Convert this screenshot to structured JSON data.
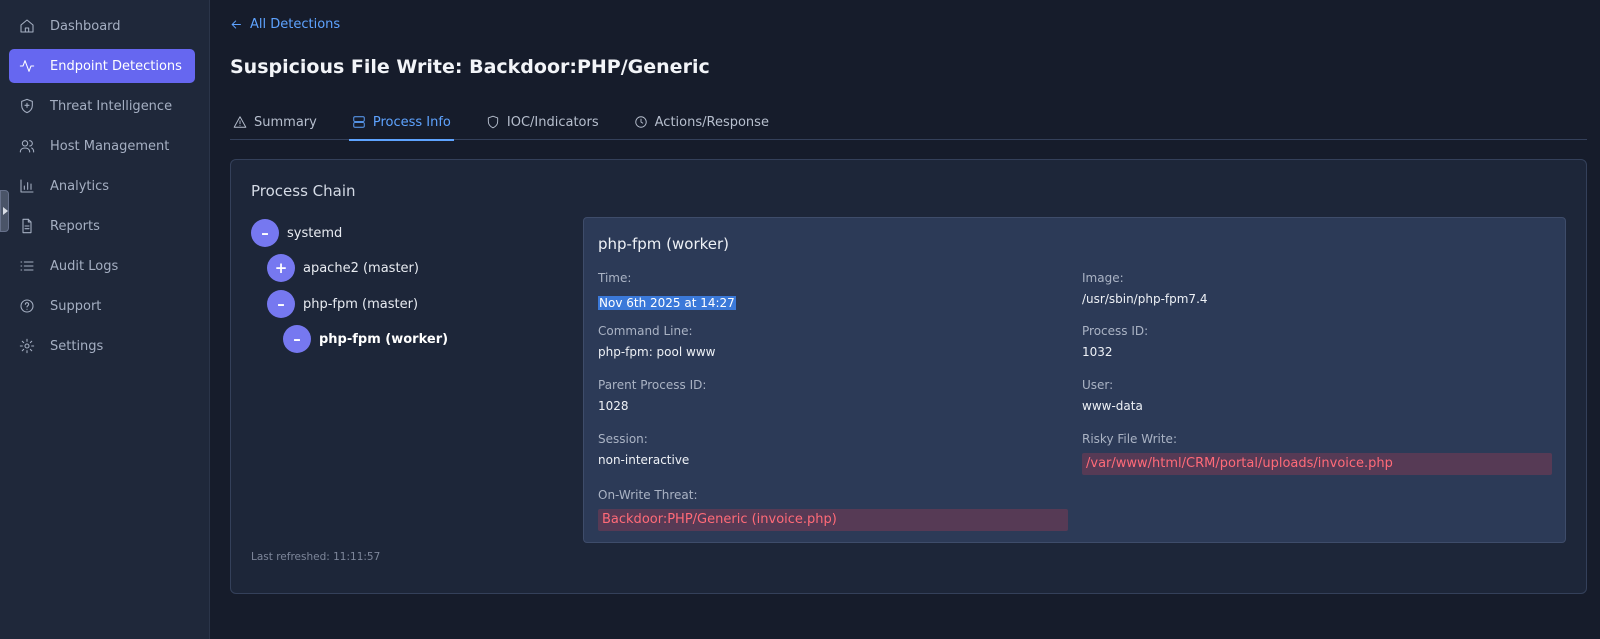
{
  "sidebar": {
    "items": [
      {
        "label": "Dashboard",
        "icon": "home-icon",
        "active": false
      },
      {
        "label": "Endpoint Detections",
        "icon": "activity-icon",
        "active": true
      },
      {
        "label": "Threat Intelligence",
        "icon": "shield-plus-icon",
        "active": false
      },
      {
        "label": "Host Management",
        "icon": "users-icon",
        "active": false
      },
      {
        "label": "Analytics",
        "icon": "bar-chart-icon",
        "active": false
      },
      {
        "label": "Reports",
        "icon": "file-text-icon",
        "active": false
      },
      {
        "label": "Audit Logs",
        "icon": "list-icon",
        "active": false
      },
      {
        "label": "Support",
        "icon": "help-circle-icon",
        "active": false
      },
      {
        "label": "Settings",
        "icon": "gear-icon",
        "active": false
      }
    ]
  },
  "header": {
    "back_label": "All Detections",
    "title": "Suspicious File Write: Backdoor:PHP/Generic"
  },
  "tabs": [
    {
      "label": "Summary",
      "icon": "alert-triangle-icon",
      "active": false
    },
    {
      "label": "Process Info",
      "icon": "server-icon",
      "active": true
    },
    {
      "label": "IOC/Indicators",
      "icon": "shield-icon",
      "active": false
    },
    {
      "label": "Actions/Response",
      "icon": "clock-icon",
      "active": false
    }
  ],
  "process_chain": {
    "title": "Process Chain",
    "nodes": [
      {
        "label": "systemd",
        "toggle": "–"
      },
      {
        "label": "apache2 (master)",
        "toggle": "+"
      },
      {
        "label": "php-fpm (master)",
        "toggle": "–"
      },
      {
        "label": "php-fpm (worker)",
        "toggle": "–"
      }
    ]
  },
  "detail": {
    "title": "php-fpm (worker)",
    "fields": {
      "time": {
        "label": "Time:",
        "value": "Nov 6th 2025 at 14:27"
      },
      "image": {
        "label": "Image:",
        "value": "/usr/sbin/php-fpm7.4"
      },
      "command_line": {
        "label": "Command Line:",
        "value": "php-fpm: pool www"
      },
      "process_id": {
        "label": "Process ID:",
        "value": "1032"
      },
      "parent_process_id": {
        "label": "Parent Process ID:",
        "value": "1028"
      },
      "user": {
        "label": "User:",
        "value": "www-data"
      },
      "session": {
        "label": "Session:",
        "value": "non-interactive"
      },
      "risky_file_write": {
        "label": "Risky File Write:",
        "value": "/var/www/html/CRM/portal/uploads/invoice.php"
      },
      "on_write_threat": {
        "label": "On-Write Threat:",
        "value": "Backdoor:PHP/Generic (invoice.php)"
      }
    }
  },
  "footer": {
    "last_refreshed": "Last refreshed: 11:11:57"
  },
  "colors": {
    "accent": "#6667f0",
    "link": "#5ea3ff",
    "danger": "#ff6a78",
    "background": "#161c2b"
  }
}
